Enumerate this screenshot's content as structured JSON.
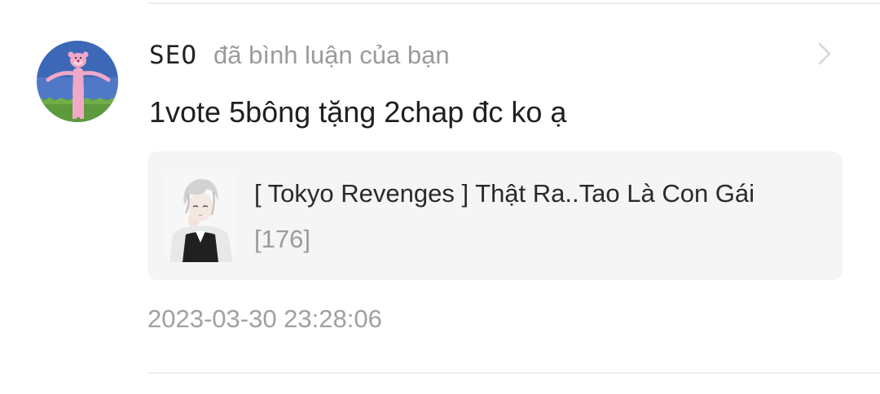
{
  "notification": {
    "username": "SEO",
    "action_text": "đã bình luận của bạn",
    "comment": "1vote 5bông tặng 2chap đc ko ạ",
    "story": {
      "title": "[ Tokyo Revenges ] Thật Ra..Tao Là Con Gái",
      "chapter": "[176]"
    },
    "timestamp": "2023-03-30 23:28:06"
  },
  "icons": {
    "chevron": "chevron-right-icon",
    "avatar": "pink-panther-avatar",
    "cover": "anime-boy-cover"
  },
  "colors": {
    "username": "#222222",
    "secondary_text": "#9b9b9b",
    "card_background": "#f5f5f5",
    "divider": "#ececec"
  }
}
